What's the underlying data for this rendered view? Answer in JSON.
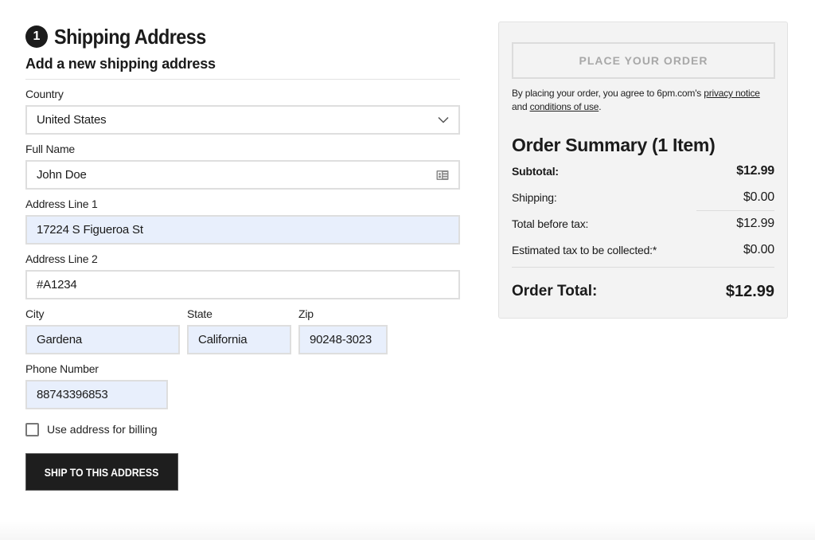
{
  "shipping": {
    "step_number": "1",
    "title": "Shipping Address",
    "subtitle": "Add a new shipping address",
    "fields": {
      "country": {
        "label": "Country",
        "value": "United States"
      },
      "full_name": {
        "label": "Full Name",
        "value": "John Doe"
      },
      "address1": {
        "label": "Address Line 1",
        "value": "17224 S Figueroa St"
      },
      "address2": {
        "label": "Address Line 2",
        "value": "#A1234"
      },
      "city": {
        "label": "City",
        "value": "Gardena"
      },
      "state": {
        "label": "State",
        "value": "California"
      },
      "zip": {
        "label": "Zip",
        "value": "90248-3023"
      },
      "phone": {
        "label": "Phone Number",
        "value": "88743396853"
      }
    },
    "billing_checkbox": {
      "label": "Use address for billing",
      "checked": false
    },
    "ship_button": "SHIP TO THIS ADDRESS",
    "icons": {
      "country_dropdown": "chevron-down-icon",
      "full_name": "contact-card-icon"
    }
  },
  "summary": {
    "place_order_button": "PLACE YOUR ORDER",
    "agreement_prefix": "By placing your order, you agree to 6pm.com's ",
    "privacy_link": "privacy notice",
    "agreement_and": "and ",
    "conditions_link": "conditions of use",
    "agreement_suffix": ".",
    "title": "Order Summary (1 Item)",
    "rows": [
      {
        "label": "Subtotal:",
        "value": "$12.99"
      },
      {
        "label": "Shipping:",
        "value": "$0.00"
      },
      {
        "label": "Total before tax:",
        "value": "$12.99"
      },
      {
        "label": "Estimated tax to be collected:*",
        "value": "$0.00"
      }
    ],
    "order_total_label": "Order Total:",
    "order_total_value": "$12.99"
  },
  "colors": {
    "autofill_bg": "#e8effc",
    "button_dark": "#1e1e1e",
    "panel_bg": "#f3f3f3",
    "disabled_text": "#a8a8a8"
  }
}
